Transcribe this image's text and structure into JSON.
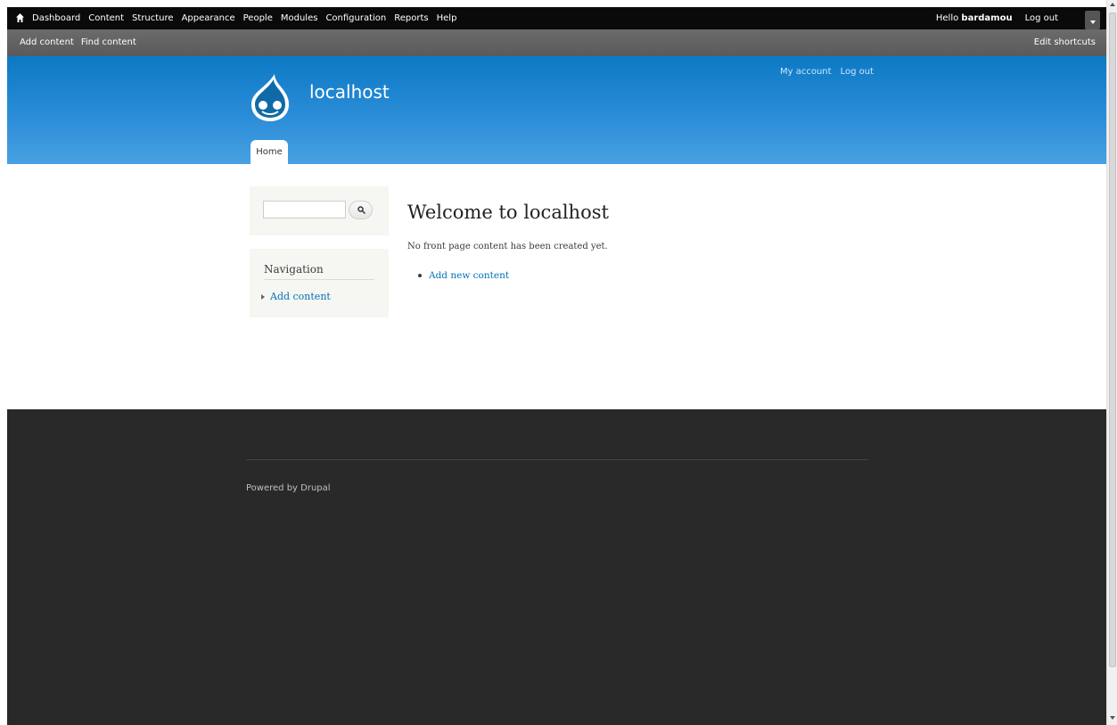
{
  "toolbar": {
    "home_icon": "home-icon",
    "menu": [
      "Dashboard",
      "Content",
      "Structure",
      "Appearance",
      "People",
      "Modules",
      "Configuration",
      "Reports",
      "Help"
    ],
    "hello_prefix": "Hello",
    "username": "bardamou",
    "logout": "Log out"
  },
  "shortcuts": {
    "left": [
      "Add content",
      "Find content"
    ],
    "edit": "Edit shortcuts"
  },
  "header": {
    "site_name": "localhost",
    "secondary_menu": [
      "My account",
      "Log out"
    ],
    "tab_home": "Home",
    "colors": {
      "top": "#0c79c4",
      "bottom": "#49a1e2"
    }
  },
  "search": {
    "value": ""
  },
  "navigation": {
    "title": "Navigation",
    "items": [
      "Add content"
    ]
  },
  "main": {
    "title": "Welcome to localhost",
    "message": "No front page content has been created yet.",
    "links": [
      "Add new content"
    ]
  },
  "footer": {
    "powered": "Powered by Drupal"
  }
}
